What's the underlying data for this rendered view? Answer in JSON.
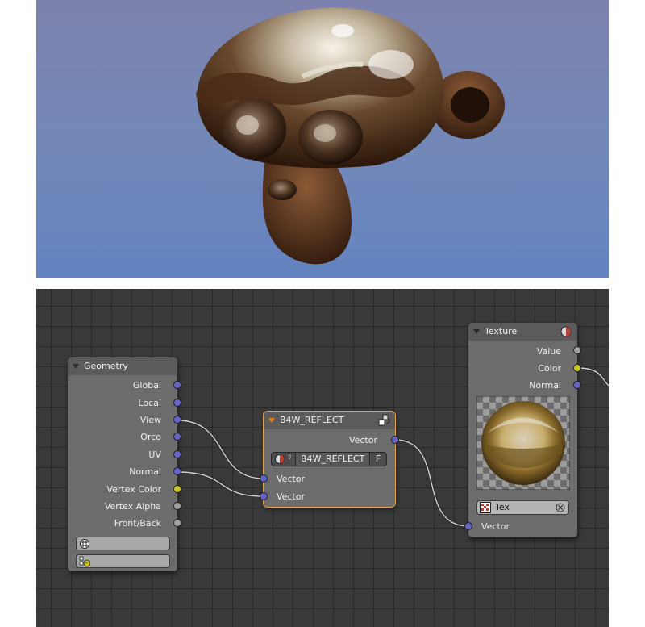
{
  "node_editor": {
    "nodes": {
      "geometry": {
        "title": "Geometry",
        "outputs": [
          "Global",
          "Local",
          "View",
          "Orco",
          "UV",
          "Normal",
          "Vertex Color",
          "Vertex Alpha",
          "Front/Back"
        ],
        "fields": [
          {
            "icon": "texture-grid-icon"
          },
          {
            "icon": "vertex-color-icon"
          }
        ]
      },
      "b4w_reflect": {
        "title": "B4W_REFLECT",
        "output": "Vector",
        "group_name": "B4W_REFLECT",
        "fake_user": "F",
        "inputs": [
          "Vector",
          "Vector"
        ]
      },
      "texture": {
        "title": "Texture",
        "outputs": [
          "Value",
          "Color",
          "Normal"
        ],
        "texture_name": "Tex",
        "input": "Vector"
      }
    }
  },
  "colors": {
    "socket_vector": "#6464c8",
    "socket_color": "#c7c729",
    "socket_value": "#a1a1a1",
    "selection": "#e8a33a"
  }
}
